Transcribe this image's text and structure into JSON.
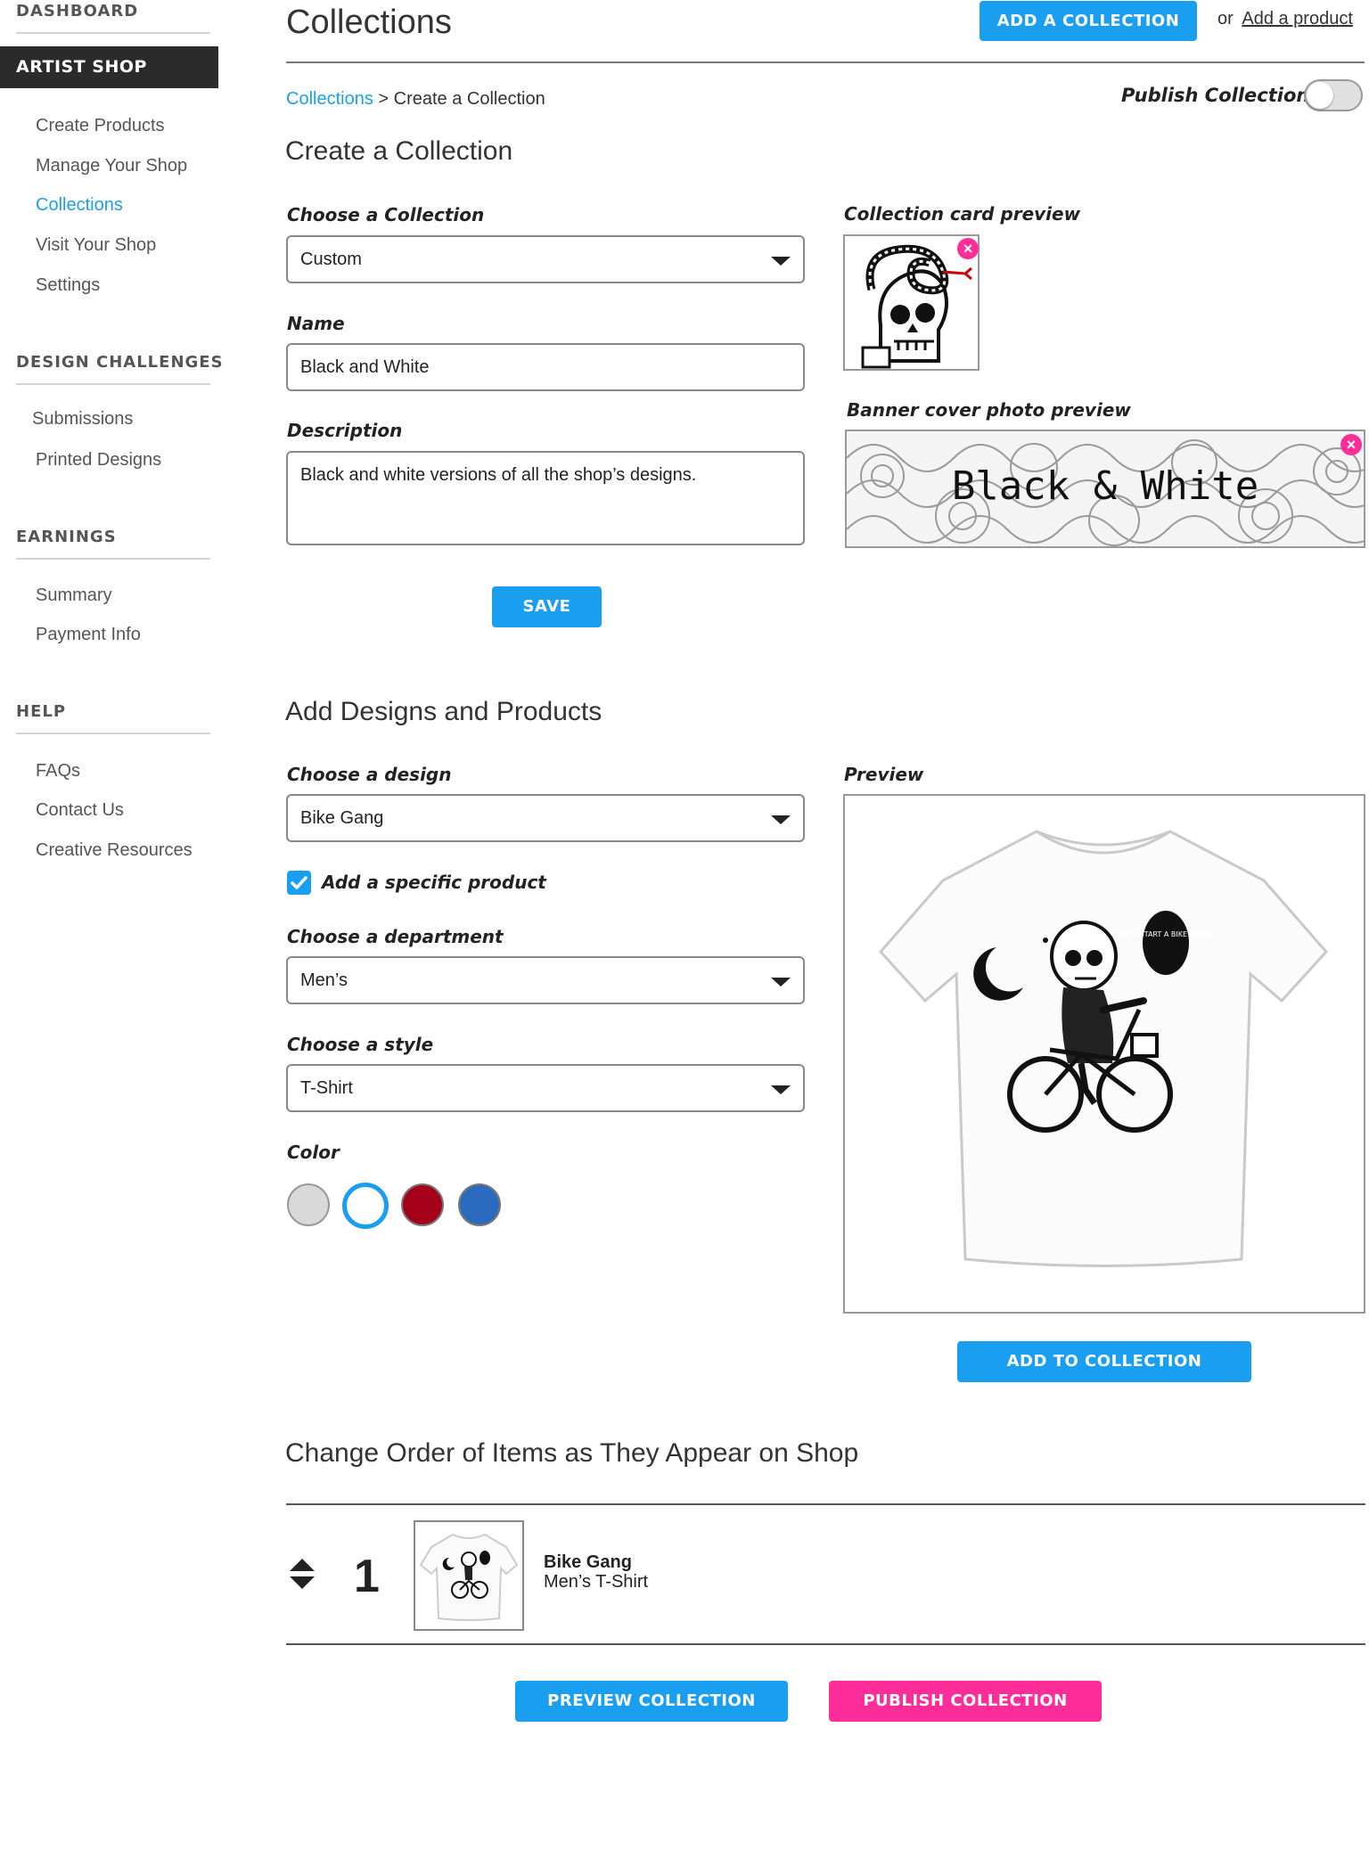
{
  "sidebar": {
    "dashboard": "DASHBOARD",
    "artist_shop": "ARTIST SHOP",
    "shop_items": [
      "Create Products",
      "Manage Your Shop",
      "Collections",
      "Visit Your Shop",
      "Settings"
    ],
    "design_challenges": "DESIGN CHALLENGES",
    "challenge_items": [
      "Submissions",
      "Printed Designs"
    ],
    "earnings": "EARNINGS",
    "earnings_items": [
      "Summary",
      "Payment Info"
    ],
    "help": "HELP",
    "help_items": [
      "FAQs",
      "Contact Us",
      "Creative Resources"
    ]
  },
  "header": {
    "title": "Collections",
    "add_collection_label": "ADD A COLLECTION",
    "or_text": "or",
    "add_product_link": "Add a product"
  },
  "breadcrumb": {
    "link": "Collections",
    "separator": ">",
    "current": "Create a Collection"
  },
  "publish_toggle": {
    "label": "Publish Collection",
    "on": false
  },
  "create_section": {
    "title": "Create a Collection",
    "choose_label": "Choose a Collection",
    "choose_value": "Custom",
    "name_label": "Name",
    "name_value": "Black and White",
    "description_label": "Description",
    "description_value": "Black and white versions of all the shop’s designs.",
    "save_label": "SAVE",
    "card_preview_label": "Collection card preview",
    "banner_preview_label": "Banner cover photo preview",
    "banner_text": "Black & White"
  },
  "designs_section": {
    "title": "Add Designs and Products",
    "design_label": "Choose a design",
    "design_value": "Bike Gang",
    "specific_product_label": "Add a specific product",
    "specific_product_checked": true,
    "department_label": "Choose a department",
    "department_value": "Men’s",
    "style_label": "Choose a style",
    "style_value": "T-Shirt",
    "color_label": "Color",
    "colors": [
      {
        "hex": "#d9d9d9",
        "selected": false
      },
      {
        "hex": "#ffffff",
        "selected": true
      },
      {
        "hex": "#a5001a",
        "selected": false
      },
      {
        "hex": "#2a6bbf",
        "selected": false
      }
    ],
    "preview_label": "Preview",
    "shirt_bubble_text": "LET'S START A BIKE GANG!",
    "add_to_collection_label": "ADD TO COLLECTION"
  },
  "order_section": {
    "title": "Change Order of Items as They Appear on Shop",
    "items": [
      {
        "position": "1",
        "name": "Bike Gang",
        "subtitle": "Men’s T-Shirt"
      }
    ]
  },
  "footer": {
    "preview_label": "PREVIEW COLLECTION",
    "publish_label": "PUBLISH COLLECTION"
  },
  "colors": {
    "accent_blue": "#1a9ef0",
    "accent_pink": "#ff2d9a",
    "sidebar_active_bg": "#2b2b2b"
  }
}
